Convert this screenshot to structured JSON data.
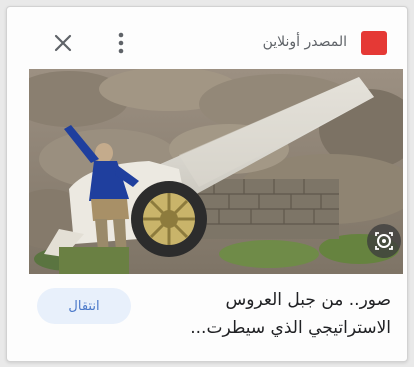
{
  "source": {
    "name": "المصدر أونلاين",
    "logo_color": "#e53935"
  },
  "header": {
    "close_icon": "close-icon",
    "menu_icon": "more-vertical-icon"
  },
  "image": {
    "description_icon": "lens-search-icon"
  },
  "article": {
    "headline": "صور.. من جبل العروس الاستراتيجي الذي سيطرت..."
  },
  "actions": {
    "open_label": "انتقال"
  },
  "colors": {
    "accent": "#4a78c9",
    "button_bg": "#e8f0fb"
  }
}
